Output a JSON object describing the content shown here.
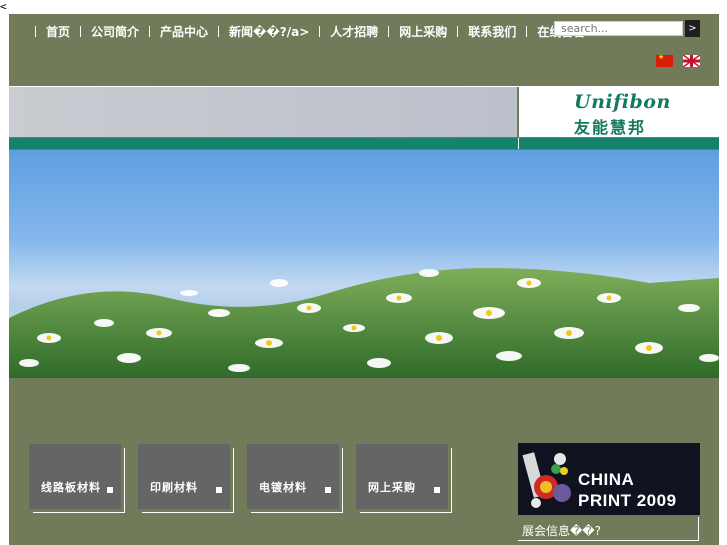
{
  "stray_text": "<",
  "nav": {
    "items": [
      {
        "label": "首页"
      },
      {
        "label": "公司简介"
      },
      {
        "label": "产品中心"
      },
      {
        "label": "新闻��?/a>"
      },
      {
        "label": "人才招聘"
      },
      {
        "label": "网上采购"
      },
      {
        "label": "联系我们"
      },
      {
        "label": "在线留言"
      }
    ]
  },
  "search": {
    "placeholder": "search...",
    "go_label": ">"
  },
  "flags": {
    "cn": "cn-flag-icon",
    "uk": "uk-flag-icon"
  },
  "logo": {
    "english": "Unifibon",
    "chinese": "友能慧邦",
    "color": "#137a60"
  },
  "cards": [
    {
      "label": "线路板材料"
    },
    {
      "label": "印刷材料"
    },
    {
      "label": "电镀材料"
    },
    {
      "label": "网上采购"
    }
  ],
  "promo": {
    "line1": "CHINA",
    "line2": "PRINT 2009",
    "caption": "展会信息��?"
  },
  "colors": {
    "page_bg": "#717b59",
    "accent_teal": "#17826b",
    "card_bg": "#656565"
  }
}
